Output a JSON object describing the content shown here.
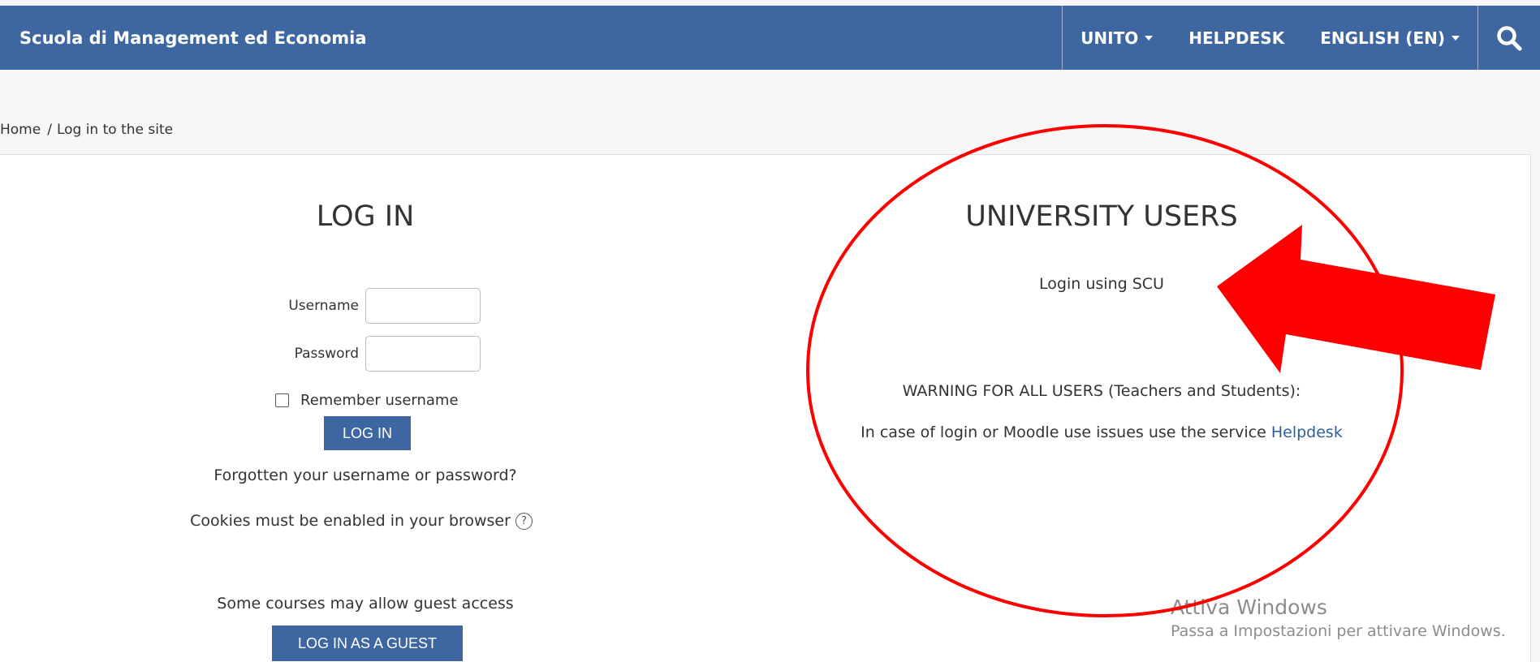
{
  "navbar": {
    "brand": "Scuola di Management ed Economia",
    "items": [
      {
        "label": "UNITO",
        "dropdown": true
      },
      {
        "label": "HELPDESK",
        "dropdown": false
      },
      {
        "label": "ENGLISH (EN)",
        "dropdown": true
      }
    ],
    "search_icon": "search-icon",
    "color": "#3e67a1"
  },
  "breadcrumb": {
    "home": "Home",
    "separator": "/",
    "current": "Log in to the site"
  },
  "login": {
    "title": "LOG IN",
    "username_label": "Username",
    "username_value": "",
    "password_label": "Password",
    "password_value": "",
    "remember_label": "Remember username",
    "remember_checked": false,
    "submit_label": "LOG IN",
    "forgot_link": "Forgotten your username or password?",
    "cookies_text": "Cookies must be enabled in your browser",
    "cookies_help_icon": "help-icon",
    "guest_text": "Some courses may allow guest access",
    "guest_button": "LOG IN AS A GUEST"
  },
  "university": {
    "title": "UNIVERSITY USERS",
    "scu_link": "Login using SCU",
    "warning": "WARNING FOR ALL USERS (Teachers and Students):",
    "issues_text": "In case of login or Moodle use issues use the service",
    "helpdesk_link": "Helpdesk"
  },
  "watermark": {
    "title": "Attiva Windows",
    "subtitle": "Passa a Impostazioni per attivare Windows."
  },
  "annotation": {
    "color": "#ff0000"
  }
}
